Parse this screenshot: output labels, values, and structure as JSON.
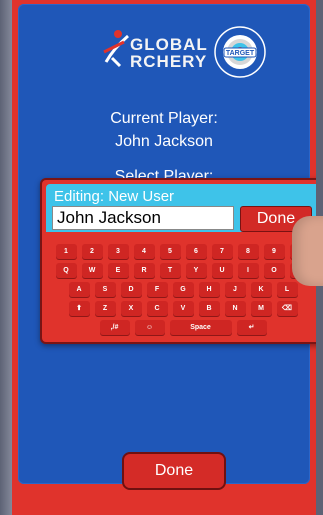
{
  "brand": {
    "line1": "GLOBAL",
    "line2": "RCHERY",
    "badge_top": "INTERACTIVE",
    "badge_mid": "TARGET",
    "badge_bottom": "EXPERIENCE"
  },
  "status": {
    "current_label": "Current Player:",
    "current_name": "John Jackson",
    "select_label": "Select Player:"
  },
  "modal": {
    "title": "Editing:  New User",
    "input_value": "John Jackson",
    "done_label": "Done"
  },
  "keyboard": {
    "row1": [
      "1",
      "2",
      "3",
      "4",
      "5",
      "6",
      "7",
      "8",
      "9",
      "0"
    ],
    "row2": [
      "Q",
      "W",
      "E",
      "R",
      "T",
      "Y",
      "U",
      "I",
      "O",
      "P"
    ],
    "row3": [
      "A",
      "S",
      "D",
      "F",
      "G",
      "H",
      "J",
      "K",
      "L"
    ],
    "row4": [
      "⬆",
      "Z",
      "X",
      "C",
      "V",
      "B",
      "N",
      "M",
      "⌫"
    ],
    "row5": [
      ",/#",
      "☺",
      "Space",
      "↵"
    ]
  },
  "footer": {
    "done_label": "Done"
  },
  "colors": {
    "red": "#e0332c",
    "blue": "#1f57b8",
    "cyan": "#3ec3e9"
  }
}
